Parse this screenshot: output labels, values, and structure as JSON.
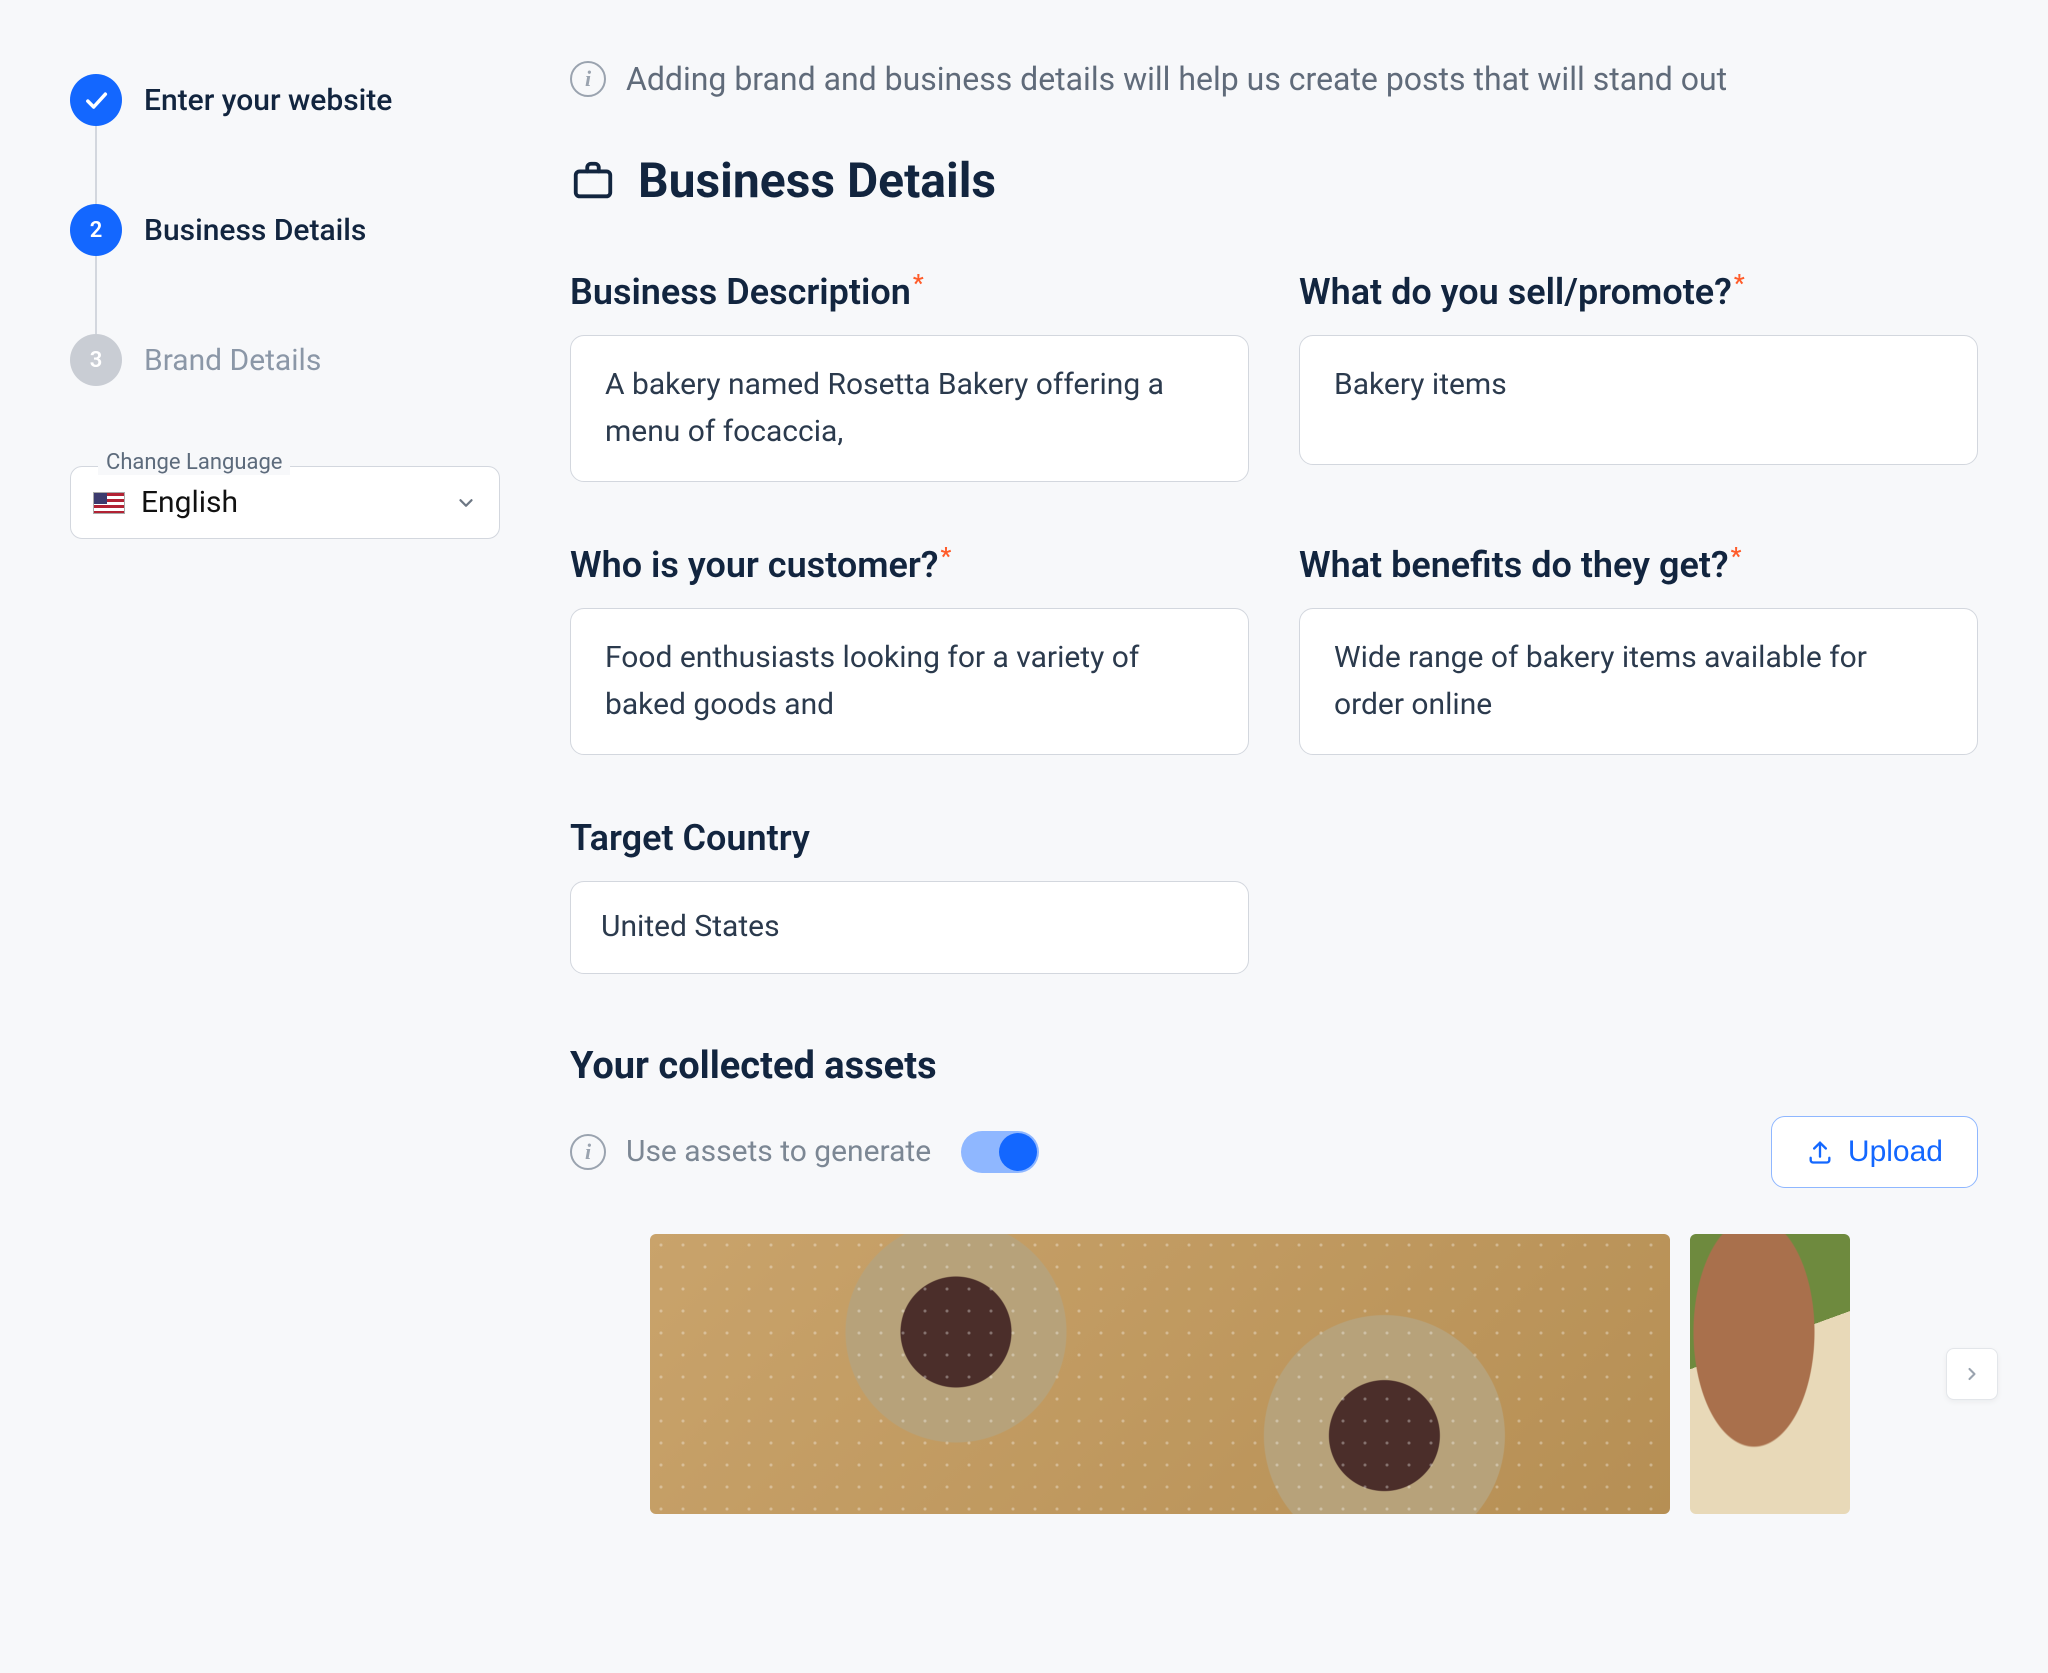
{
  "stepper": {
    "step1": {
      "label": "Enter your website"
    },
    "step2": {
      "number": "2",
      "label": "Business Details"
    },
    "step3": {
      "number": "3",
      "label": "Brand Details"
    }
  },
  "language": {
    "legend": "Change Language",
    "selected": "English"
  },
  "info_banner": "Adding brand and business details will help us create posts that will stand out",
  "section_heading": "Business Details",
  "fields": {
    "description": {
      "label": "Business Description",
      "value": "A bakery named Rosetta Bakery offering a menu of focaccia,"
    },
    "sell": {
      "label": "What do you sell/promote?",
      "value": "Bakery items"
    },
    "customer": {
      "label": "Who is your customer?",
      "value": "Food enthusiasts looking for a variety of baked goods and"
    },
    "benefits": {
      "label": "What benefits do they get?",
      "value": "Wide range of bakery items available for order online"
    },
    "country": {
      "label": "Target Country",
      "value": "United States"
    }
  },
  "assets": {
    "title": "Your collected assets",
    "toggle_hint": "Use assets to generate",
    "toggle_on": true,
    "upload_label": "Upload"
  }
}
